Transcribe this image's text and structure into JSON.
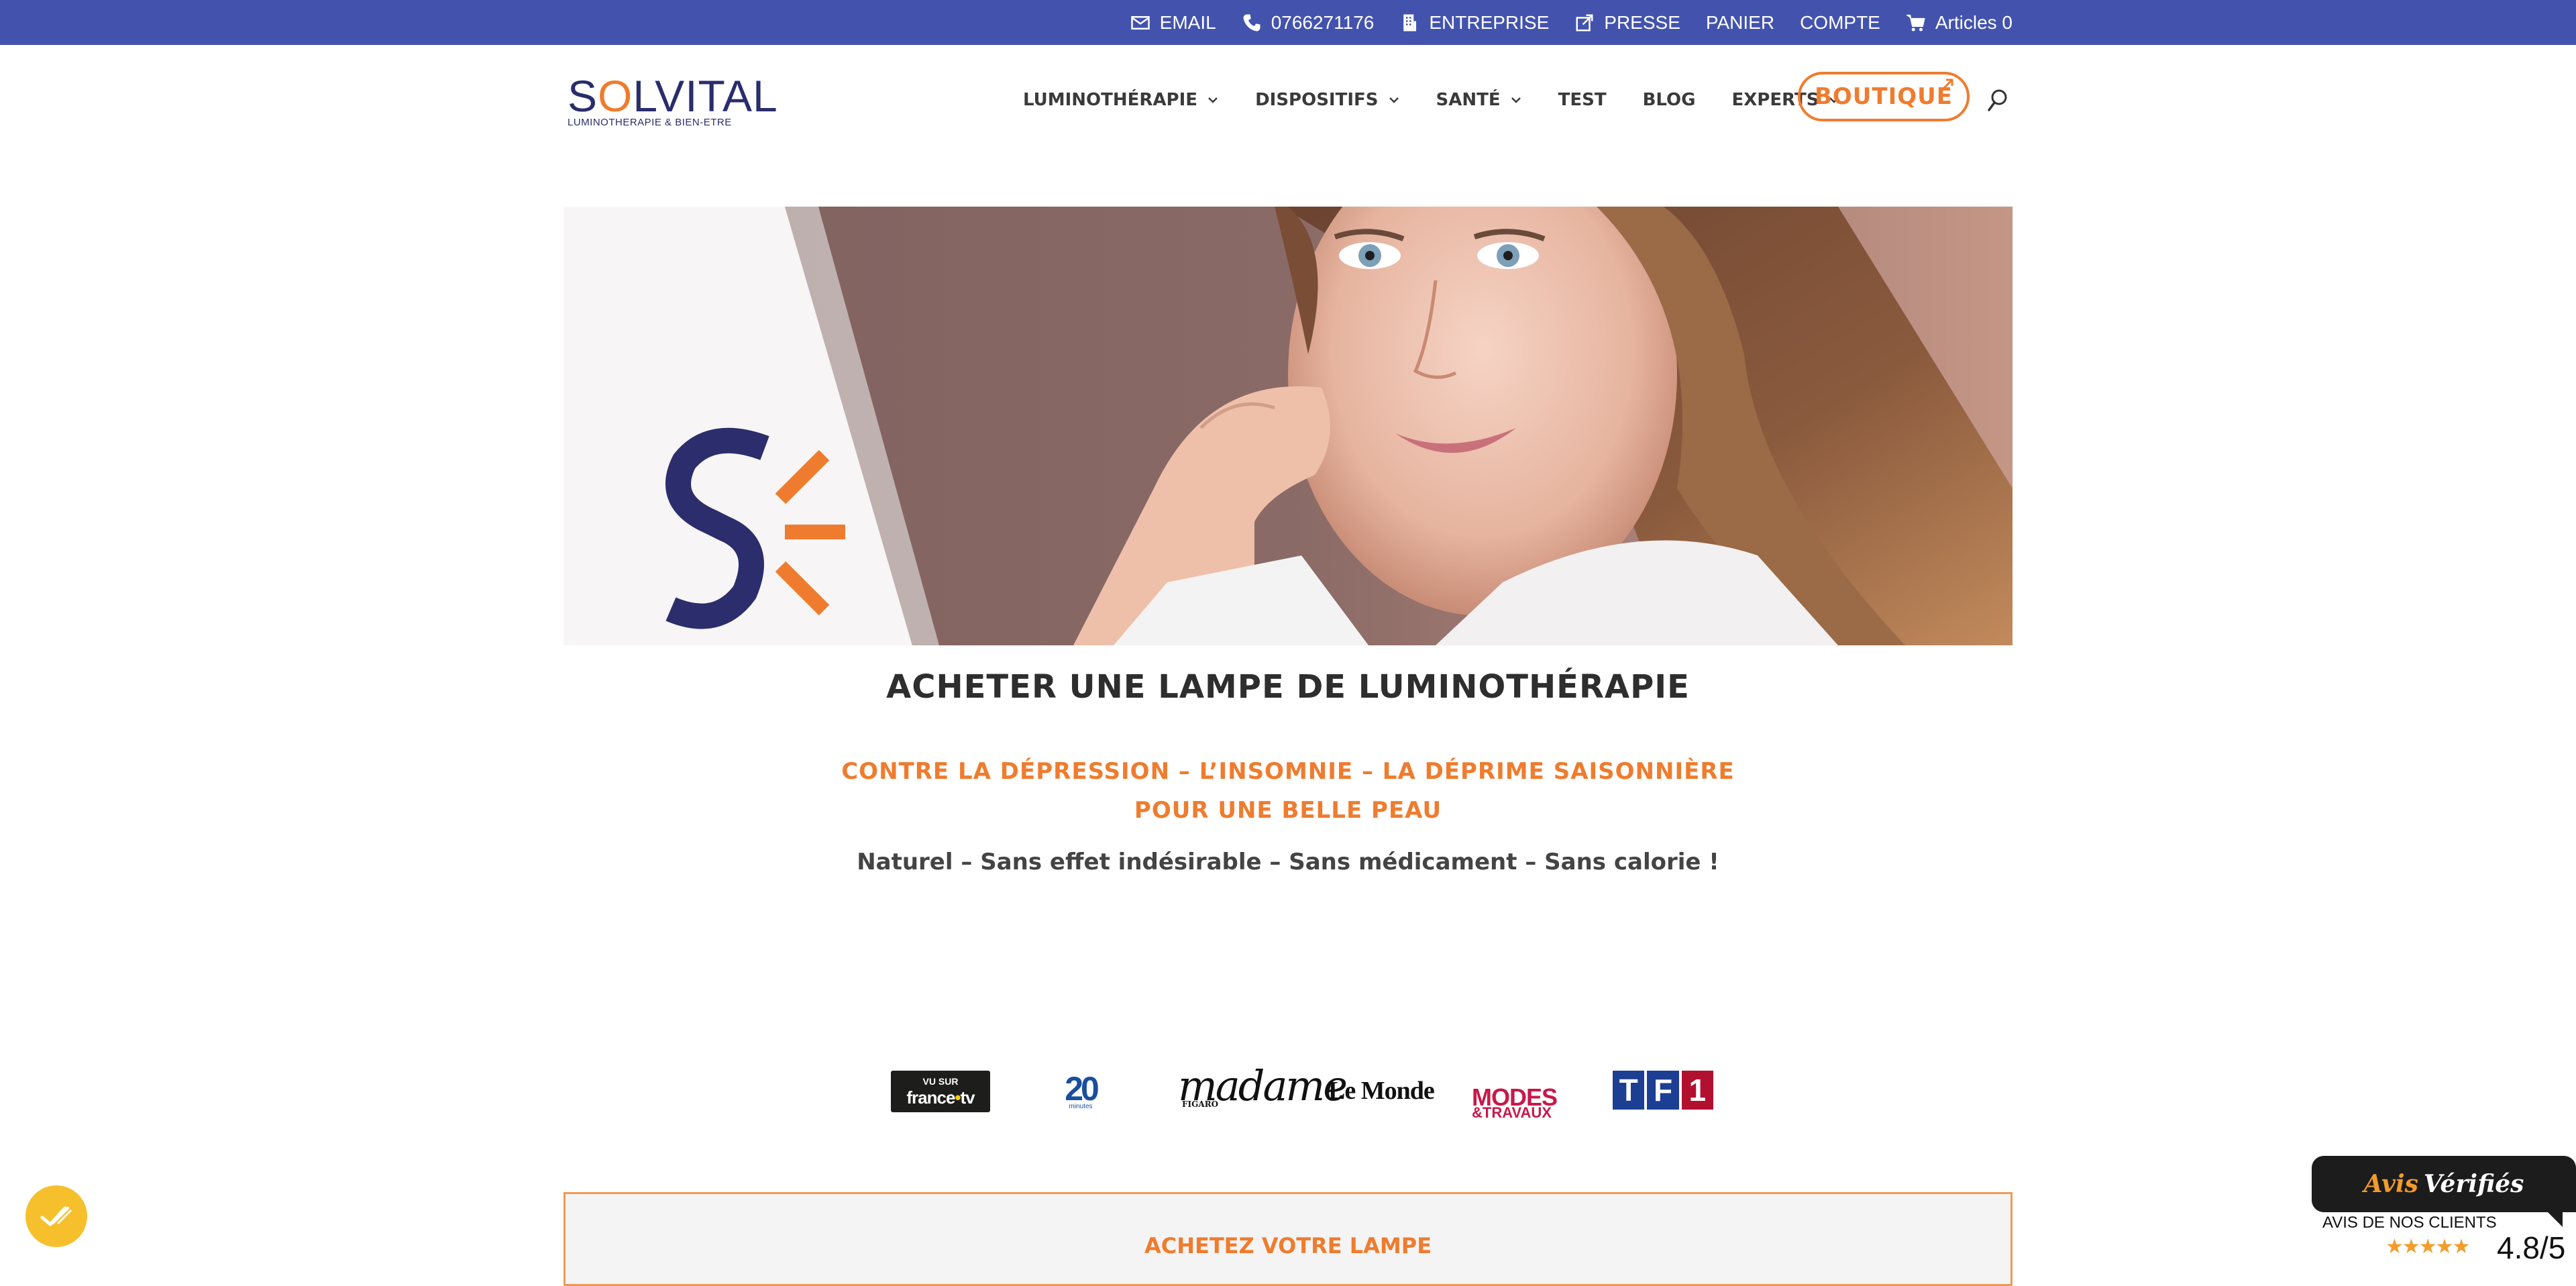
{
  "topbar": {
    "email": "EMAIL",
    "phone": "0766271176",
    "entreprise": "ENTREPRISE",
    "presse": "PRESSE",
    "panier": "PANIER",
    "compte": "COMPTE",
    "cart": "Articles 0"
  },
  "logo": {
    "word_pre": "S",
    "word_o": "O",
    "word_post": "LVITAL",
    "tagline": "LUMINOTHERAPIE & BIEN-ETRE"
  },
  "nav": {
    "items": [
      {
        "label": "LUMINOTHÉRAPIE",
        "dropdown": true
      },
      {
        "label": "DISPOSITIFS",
        "dropdown": true
      },
      {
        "label": "SANTÉ",
        "dropdown": true
      },
      {
        "label": "TEST",
        "dropdown": false
      },
      {
        "label": "BLOG",
        "dropdown": false
      },
      {
        "label": "EXPERTS",
        "dropdown": true
      }
    ],
    "boutique": "BOUTIQUE"
  },
  "hero": {
    "title": "ACHETER UNE LAMPE DE LUMINOTHÉRAPIE",
    "subtitle_line1": "CONTRE LA DÉPRESSION – L’INSOMNIE – LA DÉPRIME SAISONNIÈRE",
    "subtitle_line2": "POUR UNE BELLE PEAU",
    "tagline": "Naturel – Sans effet indésirable – Sans médicament – Sans calorie !"
  },
  "press": {
    "francetv_top": "VU SUR",
    "francetv_main": "france",
    "francetv_plus": "•",
    "francetv_tv": "tv",
    "m20_big": "20",
    "m20_small": "minutes",
    "madame_big": "madame",
    "madame_small": "FIGARO",
    "lemonde": "Le Monde",
    "modes_big": "MODES",
    "modes_small": "&TRAVAUX",
    "tf1_t": "T",
    "tf1_f": "F",
    "tf1_1": "1"
  },
  "buybox": {
    "title": "ACHETEZ VOTRE LAMPE"
  },
  "avis": {
    "brand_a": "Avis",
    "brand_b": "Vérifiés",
    "label": "AVIS DE NOS CLIENTS",
    "stars": "★★★★★",
    "score": "4.8/5"
  },
  "colors": {
    "topbar": "#4353ad",
    "accent": "#ef7c2e",
    "navy": "#2a2d6b",
    "cookie": "#f6c02d"
  }
}
